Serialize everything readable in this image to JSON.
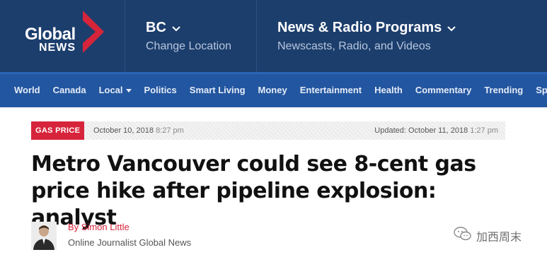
{
  "header": {
    "logo": {
      "line1": "Global",
      "line2": "NEWS"
    },
    "region": {
      "title": "BC",
      "subtitle": "Change Location"
    },
    "news_radio": {
      "title": "News & Radio Programs",
      "subtitle": "Newscasts, Radio, and Videos"
    },
    "colors": {
      "header_bg": "#1c3e6d",
      "nav_bg": "#2356a0",
      "brand_red": "#d6243b"
    }
  },
  "nav": {
    "items": [
      {
        "label": "World"
      },
      {
        "label": "Canada"
      },
      {
        "label": "Local",
        "has_dropdown": true
      },
      {
        "label": "Politics"
      },
      {
        "label": "Smart Living"
      },
      {
        "label": "Money"
      },
      {
        "label": "Entertainment"
      },
      {
        "label": "Health"
      },
      {
        "label": "Commentary"
      },
      {
        "label": "Trending"
      },
      {
        "label": "Sports"
      }
    ]
  },
  "article": {
    "tag": "GAS PRICE",
    "published_date": "October 10, 2018",
    "published_time": "8:27 pm",
    "updated_label": "Updated:",
    "updated_date": "October 11, 2018",
    "updated_time": "1:27 pm",
    "headline": "Metro Vancouver could see 8-cent gas price hike after pipeline explosion: analyst",
    "author": {
      "byline": "By Simon Little",
      "role": "Online Journalist",
      "outlet": "Global News"
    }
  },
  "watermark": {
    "text": "加西周末",
    "icon": "wechat-icon"
  }
}
